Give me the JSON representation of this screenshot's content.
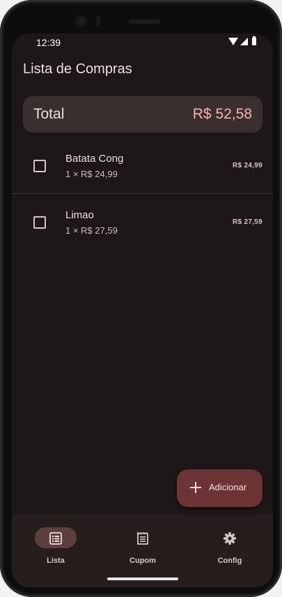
{
  "status_bar": {
    "time": "12:39"
  },
  "app": {
    "title": "Lista de Compras"
  },
  "total": {
    "label": "Total",
    "value": "R$ 52,58",
    "value_color": "#f5b3b2"
  },
  "items": [
    {
      "name": "Batata Cong",
      "detail": "1 × R$ 24,99",
      "price": "R$ 24,99",
      "checked": false
    },
    {
      "name": "Limao",
      "detail": "1 × R$ 27,59",
      "price": "R$ 27,59",
      "checked": false
    }
  ],
  "fab": {
    "label": "Adicionar",
    "icon": "plus-icon",
    "color": "#6c3435"
  },
  "nav": [
    {
      "label": "Lista",
      "icon": "list-icon",
      "active": true
    },
    {
      "label": "Cupom",
      "icon": "receipt-icon",
      "active": false
    },
    {
      "label": "Config",
      "icon": "gear-icon",
      "active": false
    }
  ],
  "theme": {
    "background": "#1e1717",
    "accent": "#6c3435"
  }
}
